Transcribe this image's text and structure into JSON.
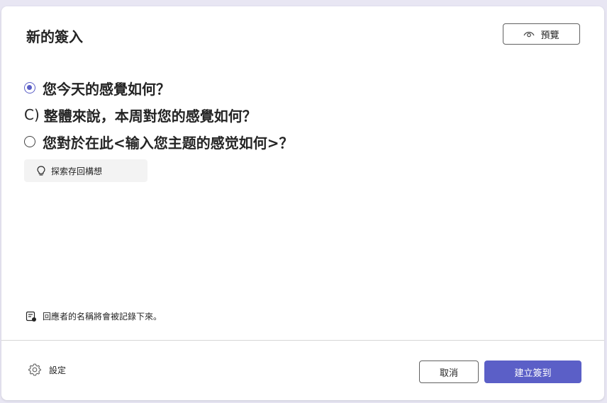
{
  "dialog": {
    "title": "新的簽入",
    "preview_label": "預覽"
  },
  "options": [
    {
      "text": "您今天的感覺如何？",
      "checked": true
    },
    {
      "prefix": "C)",
      "text": "整體來說，本周對您的感覺如何？"
    },
    {
      "text": "您對於在此<输入您主题的感觉如何>？",
      "checked": false
    }
  ],
  "explore_label": "探索存回構想",
  "note_text": "回應者的名稱將會被記錄下來。",
  "footer": {
    "settings_label": "設定",
    "cancel_label": "取消",
    "create_label": "建立簽到"
  },
  "colors": {
    "accent": "#5b5fc7",
    "background": "#e8e6f3"
  },
  "icons": {
    "preview": "eye-icon",
    "explore": "lightbulb-icon",
    "note": "form-note-icon",
    "settings": "gear-icon"
  }
}
